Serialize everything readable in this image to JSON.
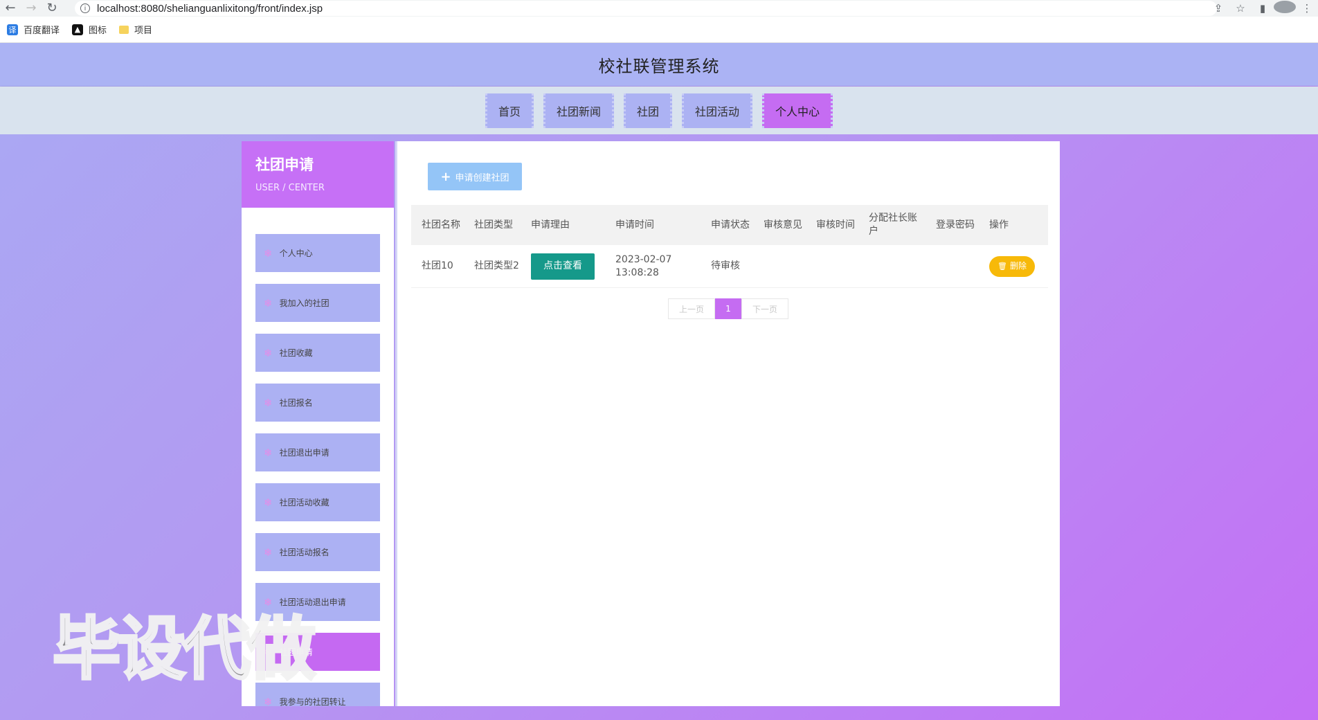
{
  "browser": {
    "url": "localhost:8080/shelianguanlixitong/front/index.jsp",
    "bookmarks": [
      {
        "label": "百度翻译",
        "icon": "translate-icon"
      },
      {
        "label": "图标",
        "icon": "image-icon"
      },
      {
        "label": "项目",
        "icon": "folder-icon"
      }
    ]
  },
  "header": {
    "title": "校社联管理系统"
  },
  "nav": {
    "items": [
      "首页",
      "社团新闻",
      "社团",
      "社团活动",
      "个人中心"
    ],
    "active_index": 4
  },
  "sidebar": {
    "title": "社团申请",
    "subtitle": "USER / CENTER",
    "items": [
      "个人中心",
      "我加入的社团",
      "社团收藏",
      "社团报名",
      "社团退出申请",
      "社团活动收藏",
      "社团活动报名",
      "社团活动退出申请",
      "社团申请",
      "我参与的社团转让"
    ],
    "active_index": 8
  },
  "main": {
    "create_button": "申请创建社团",
    "table": {
      "headers": [
        "社团名称",
        "社团类型",
        "申请理由",
        "申请时间",
        "申请状态",
        "审核意见",
        "审核时间",
        "分配社长账户",
        "登录密码",
        "操作"
      ],
      "rows": [
        {
          "name": "社团10",
          "type": "社团类型2",
          "reason_button": "点击查看",
          "time_date": "2023-02-07",
          "time_clock": "13:08:28",
          "status": "待审核",
          "opinion": "",
          "review_time": "",
          "account": "",
          "password": "",
          "delete_button": "删除"
        }
      ]
    },
    "pagination": {
      "prev": "上一页",
      "current": "1",
      "next": "下一页"
    }
  },
  "watermark": "毕设代做",
  "colors": {
    "accent": "#c56cf2",
    "nav_bg": "#acb2f3",
    "view_button": "#15998a",
    "delete_button": "#f7b909",
    "create_button": "#94c5f7"
  }
}
